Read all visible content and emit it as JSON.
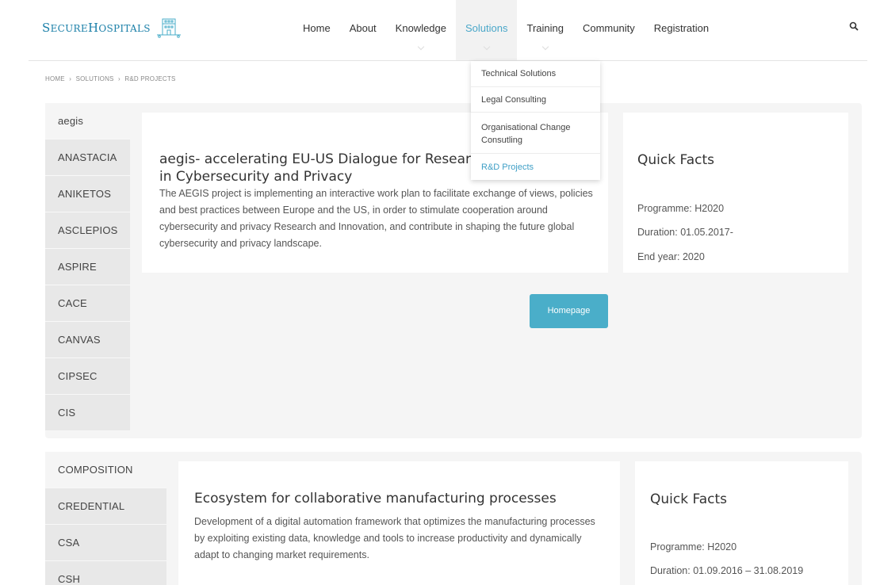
{
  "logo": {
    "text_cap1": "S",
    "text_rest1": "ECURE",
    "text_cap2": "H",
    "text_rest2": "OSPITALS"
  },
  "nav": [
    {
      "label": "Home"
    },
    {
      "label": "About"
    },
    {
      "label": "Knowledge"
    },
    {
      "label": "Solutions"
    },
    {
      "label": "Training"
    },
    {
      "label": "Community"
    },
    {
      "label": "Registration"
    }
  ],
  "dropdown": [
    {
      "label": "Technical Solutions"
    },
    {
      "label": "Legal Consulting"
    },
    {
      "label": "Organisational Change Consutling"
    },
    {
      "label": "R&D Projects"
    }
  ],
  "breadcrumb": {
    "home": "HOME",
    "sep": "›",
    "solutions": "SOLUTIONS",
    "current": "R&D PROJECTS"
  },
  "section1": {
    "tabs": [
      "aegis",
      "ANASTACIA",
      "ANIKETOS",
      "ASCLEPIOS",
      "ASPIRE",
      "CACE",
      "CANVAS",
      "CIPSEC",
      "CIS"
    ],
    "title": "aegis- accelerating EU-US Dialogue for Research & Innovation in Cybersecurity and Privacy",
    "description": "The AEGIS project is implementing an interactive work plan to facilitate exchange of views, policies and best practices between Europe and the US, in order to stimulate cooperation around cybersecurity and privacy Research and Innovation, and contribute in shaping the future global cybersecurity and privacy landscape.",
    "quick_facts_title": "Quick Facts",
    "programme": "Programme: H2020",
    "duration": "Duration: 01.05.2017-",
    "end_year": "End year: 2020",
    "button": "Homepage"
  },
  "section2": {
    "tabs": [
      "COMPOSITION",
      "CREDENTIAL",
      "CSA",
      "CSH"
    ],
    "title": "Ecosystem for collaborative manufacturing processes",
    "description": "Development of a digital automation framework that optimizes the manufacturing processes by exploiting existing data, knowledge and tools to increase productivity and dynamically adapt to changing market requirements.",
    "quick_facts_title": "Quick Facts",
    "programme": "Programme: H2020",
    "duration": "Duration: 01.09.2016 – 31.08.2019"
  },
  "colors": {
    "accent": "#4aaec9",
    "logo": "#1a7fa8",
    "panel": "#f5f5f5",
    "tab": "#e8e8e8"
  },
  "icons": {
    "search": "search-icon",
    "logo": "hospital-building-icon"
  }
}
